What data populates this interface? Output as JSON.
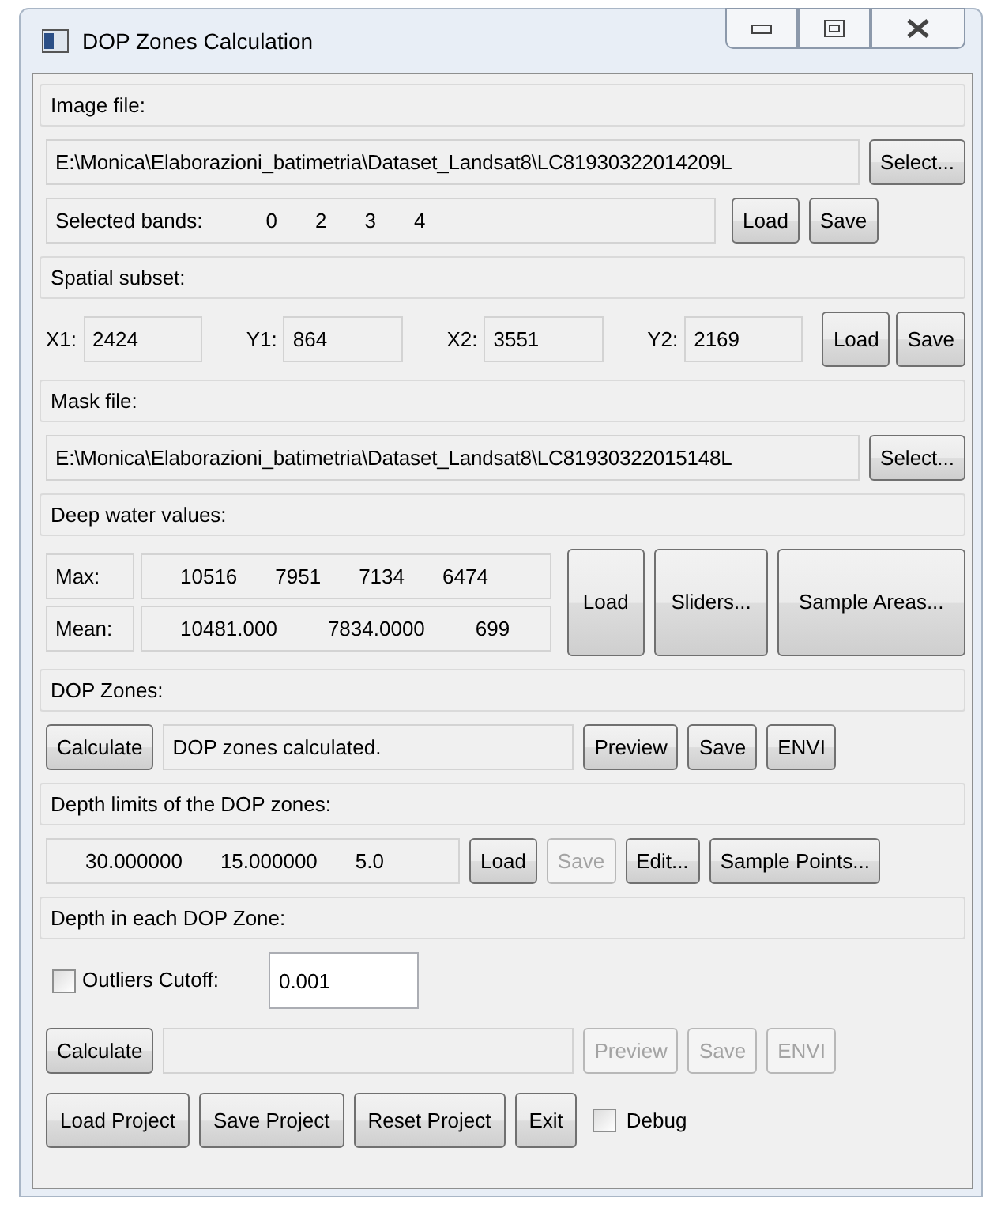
{
  "window": {
    "title": "DOP Zones Calculation"
  },
  "image_file": {
    "header": "Image file:",
    "path": "E:\\Monica\\Elaborazioni_batimetria\\Dataset_Landsat8\\LC81930322014209L",
    "select": "Select...",
    "bands_label": "Selected bands:",
    "bands": [
      "0",
      "2",
      "3",
      "4"
    ],
    "load": "Load",
    "save": "Save"
  },
  "spatial_subset": {
    "header": "Spatial subset:",
    "coords": [
      {
        "label": "X1:",
        "value": "2424"
      },
      {
        "label": "Y1:",
        "value": "864"
      },
      {
        "label": "X2:",
        "value": "3551"
      },
      {
        "label": "Y2:",
        "value": "2169"
      }
    ],
    "load": "Load",
    "save": "Save"
  },
  "mask_file": {
    "header": "Mask file:",
    "path": "E:\\Monica\\Elaborazioni_batimetria\\Dataset_Landsat8\\LC81930322015148L",
    "select": "Select..."
  },
  "deep_water": {
    "header": "Deep water values:",
    "rows": [
      {
        "label": "Max:",
        "values": [
          "10516",
          "7951",
          "7134",
          "6474"
        ]
      },
      {
        "label": "Mean:",
        "values": [
          "10481.000",
          "7834.0000",
          "699"
        ]
      }
    ],
    "buttons": [
      "Load",
      "Sliders...",
      "Sample Areas..."
    ]
  },
  "dop_zones": {
    "header": "DOP Zones:",
    "calculate": "Calculate",
    "status": "DOP zones calculated.",
    "buttons": [
      {
        "label": "Preview",
        "disabled": false
      },
      {
        "label": "Save",
        "disabled": false
      },
      {
        "label": "ENVI",
        "disabled": false
      }
    ]
  },
  "depth_limits": {
    "header": "Depth limits of the DOP zones:",
    "values": [
      "30.000000",
      "15.000000",
      "5.0"
    ],
    "buttons": [
      {
        "label": "Load",
        "disabled": false
      },
      {
        "label": "Save",
        "disabled": true
      },
      {
        "label": "Edit...",
        "disabled": false
      },
      {
        "label": "Sample Points...",
        "disabled": false
      }
    ]
  },
  "depth_each": {
    "header": "Depth in each DOP Zone:",
    "outliers": {
      "label": "Outliers Cutoff:",
      "checked": false,
      "value": "0.001"
    },
    "calculate": "Calculate",
    "buttons": [
      {
        "label": "Preview",
        "disabled": true
      },
      {
        "label": "Save",
        "disabled": true
      },
      {
        "label": "ENVI",
        "disabled": true
      }
    ]
  },
  "footer": {
    "buttons": [
      "Load Project",
      "Save Project",
      "Reset Project",
      "Exit"
    ],
    "debug": {
      "label": "Debug",
      "checked": false
    }
  }
}
